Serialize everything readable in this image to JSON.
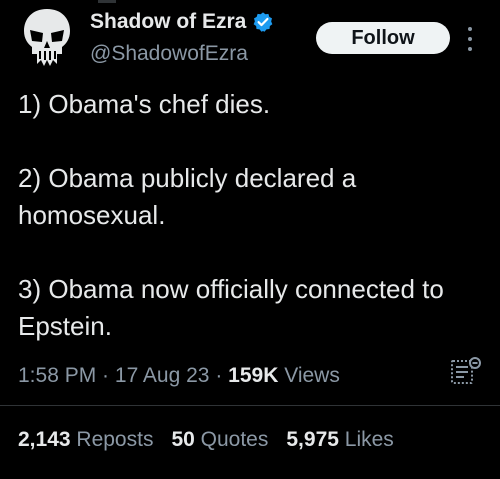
{
  "author": {
    "display_name": "Shadow of Ezra",
    "handle": "@ShadowofEzra",
    "avatar_icon": "punisher-skull-icon",
    "verified_icon": "verified-badge-icon",
    "verified_color": "#1d9bf0"
  },
  "follow_button": {
    "label": "Follow"
  },
  "more_menu_icon": "more-vertical-icon",
  "tweet": {
    "paragraphs": [
      "1) Obama's chef dies.",
      "2) Obama publicly declared a homosexual.",
      "3) Obama now officially connected to Epstein."
    ]
  },
  "meta": {
    "time": "1:58 PM",
    "separator": " · ",
    "date": "17 Aug 23",
    "views_count": "159K",
    "views_label": "Views"
  },
  "analytics_icon": "analytics-icon",
  "stats": {
    "reposts_count": "2,143",
    "reposts_label": "Reposts",
    "quotes_count": "50",
    "quotes_label": "Quotes",
    "likes_count": "5,975",
    "likes_label": "Likes"
  },
  "colors": {
    "background": "#000000",
    "text_primary": "#e7e9ea",
    "text_secondary": "#8b98a5",
    "follow_bg": "#eff3f4",
    "divider": "#2f3336"
  }
}
